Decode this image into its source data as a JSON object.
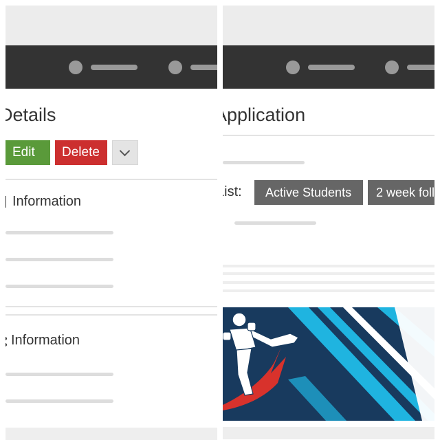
{
  "left": {
    "page_title": "Details",
    "buttons": {
      "edit": "Edit",
      "delete": "Delete"
    },
    "sections": [
      {
        "title": "Information"
      },
      {
        "title": "Information"
      }
    ]
  },
  "right": {
    "page_title": "Application",
    "list_label": "List:",
    "list_buttons": [
      "Active Students",
      "2 week foll"
    ],
    "second_label": ":"
  },
  "colors": {
    "nav_bar": "#333333",
    "edit_button": "#5a9a3a",
    "delete_button": "#cc2f2f",
    "list_button": "#666666",
    "banner_navy": "#183a5e",
    "banner_cyan": "#1fb4e0",
    "banner_red": "#d8322c"
  },
  "icons": {
    "more": "chevron-down-icon",
    "banner": "kickboxer-illustration"
  }
}
